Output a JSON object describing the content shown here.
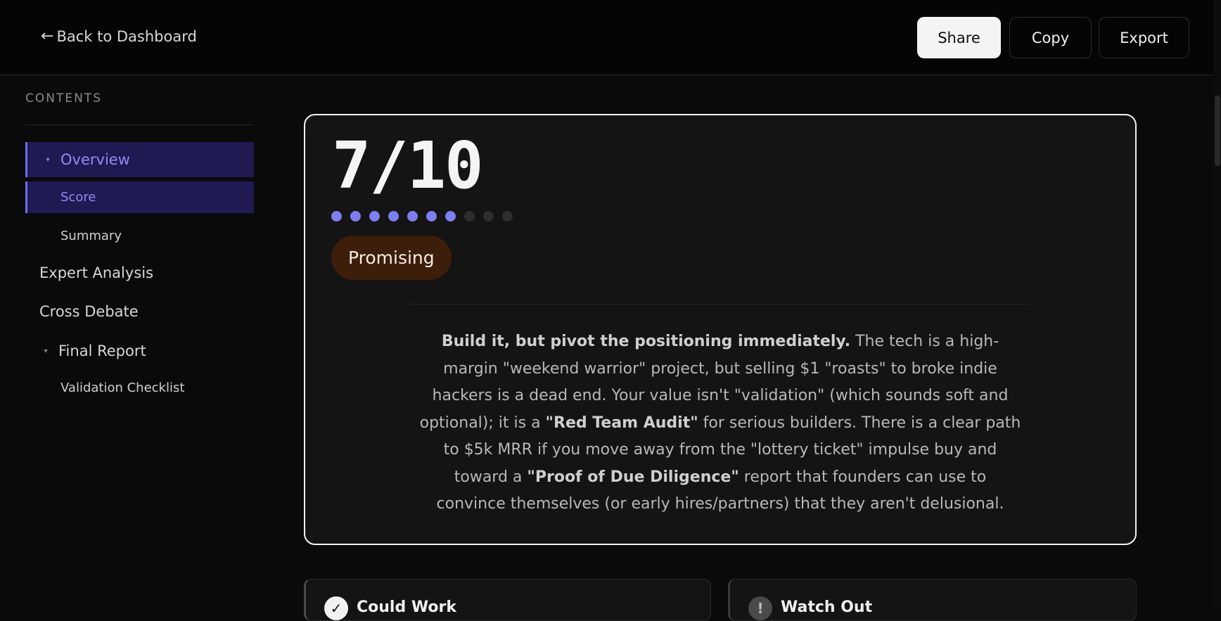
{
  "header": {
    "back_arrow": "←",
    "back_label": "Back to Dashboard",
    "share_label": "Share",
    "copy_label": "Copy",
    "export_label": "Export"
  },
  "sidebar": {
    "heading": "CONTENTS",
    "caret": "▾",
    "items": [
      {
        "label": "Overview"
      },
      {
        "label": "Score"
      },
      {
        "label": "Summary"
      },
      {
        "label": "Expert Analysis"
      },
      {
        "label": "Cross Debate"
      },
      {
        "label": "Final Report"
      },
      {
        "label": "Validation Checklist"
      }
    ]
  },
  "score": {
    "value": "7/10",
    "rating": 7,
    "max": 10,
    "badge": "Promising",
    "badge_color": "#3d1e0a",
    "accent": "#7c7ff0"
  },
  "summary": {
    "lead": "Build it, but pivot the positioning immediately.",
    "p1": " The tech is a high-margin \"weekend warrior\" project, but selling $1 \"roasts\" to broke indie hackers is a dead end. Your value isn't \"validation\" (which sounds soft and optional); it is a ",
    "b1": "\"Red Team Audit\"",
    "p2": " for serious builders. There is a clear path to $5k MRR if you move away from the \"lottery ticket\" impulse buy and toward a ",
    "b2": "\"Proof of Due Diligence\"",
    "p3": " report that founders can use to convince themselves (or early hires/partners) that they aren't delusional."
  },
  "cards": {
    "could_work": {
      "icon": "check-icon",
      "glyph": "✓",
      "title": "Could Work"
    },
    "watch_out": {
      "icon": "alert-icon",
      "glyph": "!",
      "title": "Watch Out"
    }
  }
}
